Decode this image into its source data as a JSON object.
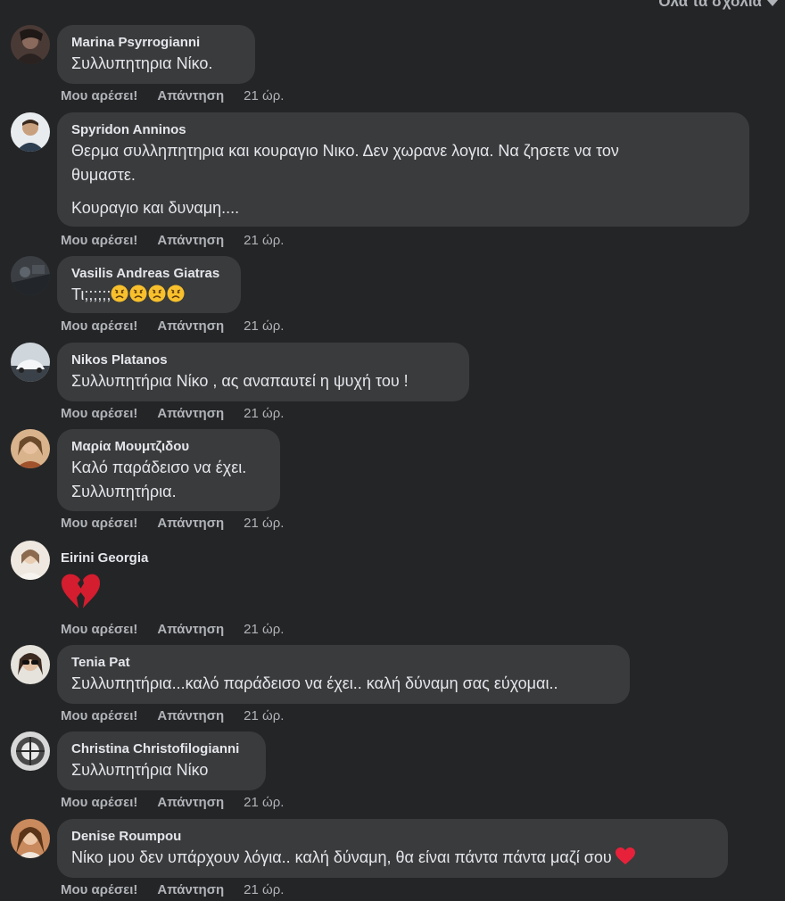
{
  "filter": {
    "label": "Όλα τα σχόλια",
    "icon": "caret-down-icon"
  },
  "labels": {
    "like": "Μου αρέσει!",
    "reply": "Απάντηση"
  },
  "comments": [
    {
      "author": "Marina Psyrrogianni",
      "lines": [
        "Συλλυπητηρια Νίκο."
      ],
      "time": "21 ώρ."
    },
    {
      "author": "Spyridon Anninos",
      "lines": [
        "Θερμα συλληπητηρια και κουραγιο Νικο. Δεν χωρανε λογια. Να ζησετε να τον",
        "θυμαστε.",
        "Κουραγιο και δυναμη...."
      ],
      "time": "21 ώρ."
    },
    {
      "author": "Vasilis Andreas Giatras",
      "lines": [
        "Τι;;;;;;"
      ],
      "emoji": [
        "sad-face-icon",
        "sad-face-icon",
        "sad-face-icon",
        "sad-face-icon"
      ],
      "time": "21 ώρ."
    },
    {
      "author": "Nikos Platanos",
      "lines": [
        "Συλλυπητήρια Νίκο , ας αναπαυτεί η ψυχή του !"
      ],
      "time": "21 ώρ."
    },
    {
      "author": "Μαρία Μουμτζιδου",
      "lines": [
        "Καλό παράδεισο να έχει.",
        "Συλλυπητήρια."
      ],
      "time": "21 ώρ."
    },
    {
      "author": "Eirini Georgia",
      "emoji": [
        "broken-heart-icon"
      ],
      "time": "21 ώρ."
    },
    {
      "author": "Tenia Pat",
      "lines": [
        "Συλλυπητήρια...καλό παράδεισο να έχει.. καλή δύναμη σας εύχομαι.."
      ],
      "time": "21 ώρ."
    },
    {
      "author": "Christina Christofilogianni",
      "lines": [
        "Συλλυπητήρια Νίκο"
      ],
      "time": "21 ώρ."
    },
    {
      "author": "Denise Roumpou",
      "lines": [
        "Νίκο μου δεν υπάρχουν λόγια.. καλή δύναμη, θα είναι πάντα πάντα μαζί σου"
      ],
      "emoji": [
        "red-heart-icon"
      ],
      "time": "21 ώρ."
    }
  ]
}
